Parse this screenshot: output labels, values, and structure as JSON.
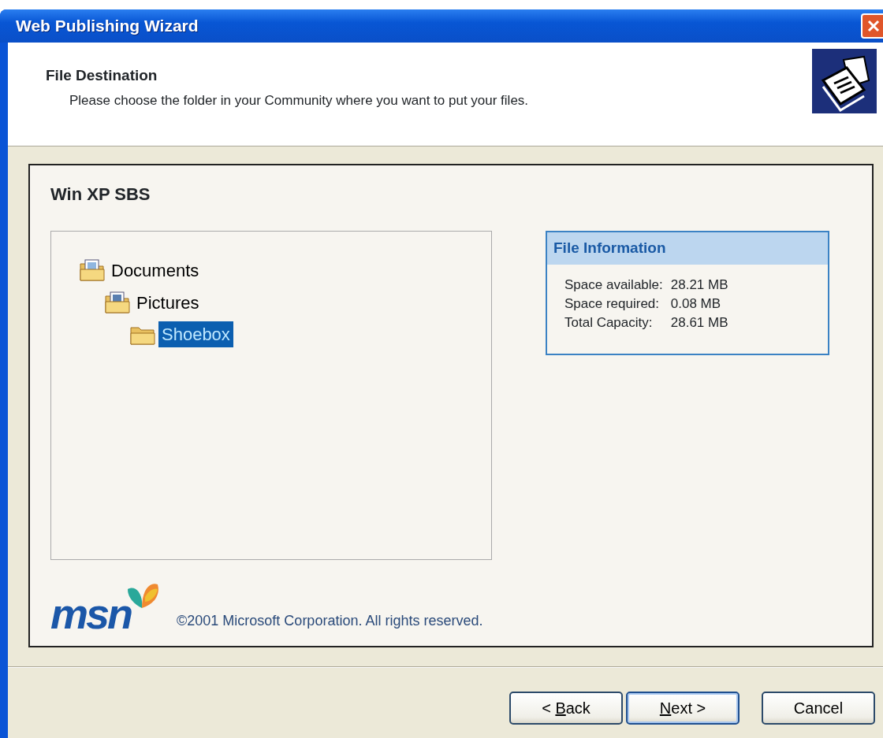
{
  "window": {
    "title": "Web Publishing Wizard"
  },
  "header": {
    "title": "File Destination",
    "subtitle": "Please choose the folder in your Community where you want to put your files."
  },
  "community": {
    "name": "Win XP SBS"
  },
  "tree": [
    {
      "label": "Documents",
      "kind": "documents",
      "selected": false,
      "children": [
        {
          "label": "Pictures",
          "kind": "pictures",
          "selected": false,
          "children": [
            {
              "label": "Shoebox",
              "kind": "folder",
              "selected": true
            }
          ]
        }
      ]
    }
  ],
  "file_information": {
    "title": "File Information",
    "rows": [
      {
        "label": "Space available:",
        "value": "28.21 MB"
      },
      {
        "label": "Space required:",
        "value": "0.08 MB"
      },
      {
        "label": "Total Capacity:",
        "value": "28.61 MB"
      }
    ]
  },
  "footer": {
    "logo": "msn",
    "copyright": "©2001 Microsoft Corporation. All rights reserved."
  },
  "buttons": [
    {
      "before": "< ",
      "mnemonic": "B",
      "after": "ack",
      "default": false
    },
    {
      "mnemonic": "N",
      "after": "ext >",
      "default": true
    },
    {
      "after": "Cancel",
      "default": false
    }
  ]
}
